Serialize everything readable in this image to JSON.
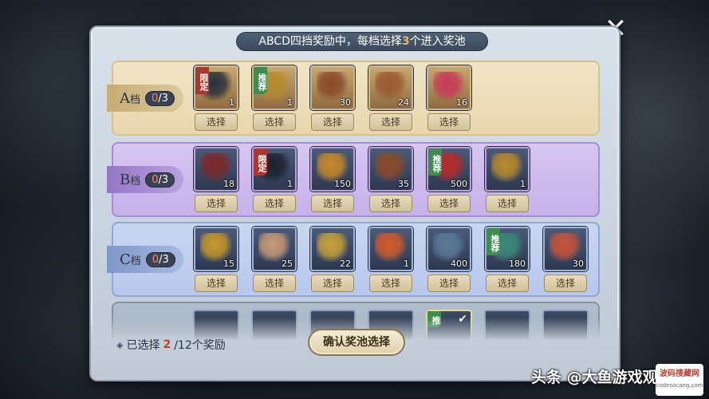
{
  "header": {
    "prefix": "ABCD四挡奖励中，每档选择",
    "highlight": "3",
    "suffix": "个进入奖池"
  },
  "tiers": [
    {
      "letter": "A",
      "suffix": "档",
      "count": "0",
      "total": "/3",
      "items": [
        {
          "qty": "1",
          "tag": "限定",
          "tag_type": "limited",
          "icon": "costume-icon",
          "color": "#2a2f3a"
        },
        {
          "qty": "1",
          "tag": "推荐",
          "tag_type": "rec",
          "icon": "gold-token-icon",
          "color": "#b88a2c"
        },
        {
          "qty": "30",
          "tag": "",
          "icon": "treasure-chest-icon",
          "color": "#8a4a2a"
        },
        {
          "qty": "24",
          "tag": "",
          "icon": "treasure-chest-icon",
          "color": "#9a5a30"
        },
        {
          "qty": "16",
          "tag": "",
          "icon": "rose-icon",
          "color": "#c83a58"
        }
      ],
      "button": "选择"
    },
    {
      "letter": "B",
      "suffix": "档",
      "count": "0",
      "total": "/3",
      "items": [
        {
          "qty": "18",
          "tag": "",
          "icon": "jewelry-box-icon",
          "color": "#7a2a2a"
        },
        {
          "qty": "1",
          "tag": "限定",
          "tag_type": "limited",
          "icon": "character-icon",
          "color": "#1e2230"
        },
        {
          "qty": "150",
          "tag": "",
          "icon": "gold-ore-icon",
          "color": "#c88a2a"
        },
        {
          "qty": "35",
          "tag": "",
          "icon": "treasure-chest-icon",
          "color": "#8a4a2a"
        },
        {
          "qty": "500",
          "tag": "推荐",
          "tag_type": "rec",
          "icon": "red-envelope-icon",
          "color": "#b82a2a"
        },
        {
          "qty": "1",
          "tag": "",
          "icon": "gold-token-icon",
          "color": "#b88a2c"
        }
      ],
      "button": "选择"
    },
    {
      "letter": "C",
      "suffix": "档",
      "count": "0",
      "total": "/3",
      "items": [
        {
          "qty": "15",
          "tag": "",
          "icon": "golden-card-icon",
          "color": "#c8982a"
        },
        {
          "qty": "25",
          "tag": "",
          "icon": "scroll-bundle-icon",
          "color": "#c89a78"
        },
        {
          "qty": "22",
          "tag": "",
          "icon": "gold-chest-icon",
          "color": "#c8a23a"
        },
        {
          "qty": "1",
          "tag": "",
          "icon": "fruit-icon",
          "color": "#d25a2a"
        },
        {
          "qty": "400",
          "tag": "",
          "icon": "stone-icon",
          "color": "#5a7a9a"
        },
        {
          "qty": "180",
          "tag": "推荐",
          "tag_type": "rec",
          "icon": "jade-token-icon",
          "color": "#3a8a7a"
        },
        {
          "qty": "30",
          "tag": "",
          "icon": "red-card-icon",
          "color": "#c8543a"
        }
      ],
      "button": "选择"
    }
  ],
  "tier_d": {
    "visible_tag": "推"
  },
  "footer": {
    "selected_prefix": "已选择",
    "selected_count": "2",
    "selected_suffix": "/12个奖励",
    "confirm_label": "确认奖池选择"
  },
  "watermark": "头条 @大鱼游戏观察",
  "site_badge": {
    "title": "波码搜藏网",
    "sub": "codesocang.com"
  },
  "colors": {
    "accent": "#f2b54a",
    "limited": "#a63a32",
    "recommended": "#3f8c4f"
  }
}
